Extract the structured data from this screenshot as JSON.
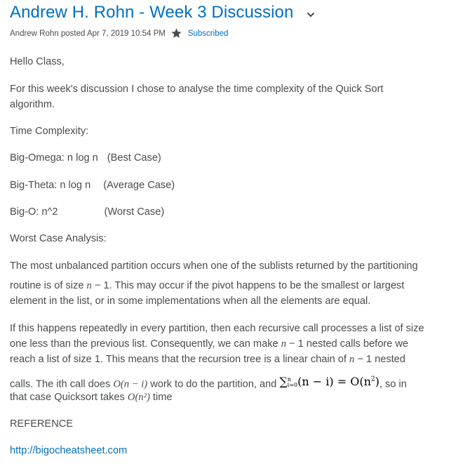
{
  "header": {
    "title": "Andrew H. Rohn - Week 3 Discussion",
    "byline": "Andrew Rohn posted Apr 7, 2019 10:54 PM",
    "subscribed_label": "Subscribed"
  },
  "colors": {
    "link": "#006fbf",
    "text": "#494c4e",
    "star": "#494c4e"
  },
  "icons": {
    "title_menu": "chevron-down-icon",
    "favorite": "star-icon"
  },
  "body": {
    "greeting": "Hello Class,",
    "intro_line1": "For this week's discussion I chose to analyse the time complexity of the Quick Sort",
    "intro_line2": "algorithm.",
    "tc_heading": "Time Complexity:",
    "omega_label": "Big-Omega:  n log n",
    "omega_case": "(Best Case)",
    "theta_label": "Big-Theta:  n log n",
    "theta_case": "(Average Case)",
    "o_label": "Big-O:  n^2",
    "o_case": "(Worst Case)",
    "wca_heading": "Worst Case Analysis:",
    "para1_line1": "The most unbalanced partition occurs when one of the sublists returned by the partitioning",
    "para1_line2a": "routine is of size ",
    "para1_line2_n": "n",
    "para1_line2b": " − 1. This may occur if the pivot happens to be the smallest or largest",
    "para1_line3": "element in the list, or in some implementations when all the elements are equal.",
    "para2_line1": "If this happens repeatedly in every partition, then each recursive call processes a list of size",
    "para2_line2a": "one less than the previous list. Consequently, we can make ",
    "para2_line2_n": "n",
    "para2_line2b": " − 1 nested calls before we",
    "para2_line3a": "reach a list of size 1. This means that the recursion tree is a linear chain of ",
    "para2_line3_n": "n",
    "para2_line3b": " − 1 nested",
    "para2_line4a": "calls. The ith call does ",
    "para2_line4_on": "O(n − i)",
    "para2_line4b": " work to do the partition, and ",
    "formula_sum": "∑",
    "formula_top": "n",
    "formula_bottom": "i=0",
    "formula_rest": "(n − i) = O(n",
    "formula_exp": "2",
    "formula_close": ")",
    "para2_line4c": ", so in",
    "para2_line5a": "that case Quicksort takes ",
    "para2_line5_on2": "O(n²)",
    "para2_line5b": " time",
    "reference_heading": "REFERENCE",
    "reference_link": "http://bigocheatsheet.com"
  }
}
